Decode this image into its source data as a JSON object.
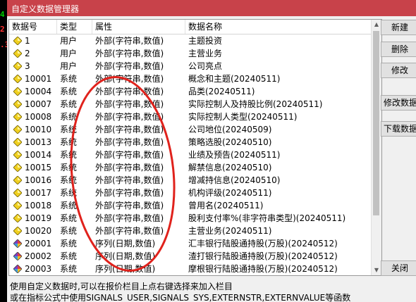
{
  "left_strip": [
    "4",
    "2",
    ".3"
  ],
  "title": "自定义数据管理器",
  "columns": [
    "数据号",
    "类型",
    "属性",
    "数据名称"
  ],
  "rows": [
    {
      "id": "1",
      "type": "用户",
      "attr": "外部(字符串,数值)",
      "name": "主题投资",
      "icon": "yellow-diamond-icon"
    },
    {
      "id": "2",
      "type": "用户",
      "attr": "外部(字符串,数值)",
      "name": "主营业务",
      "icon": "yellow-diamond-icon"
    },
    {
      "id": "3",
      "type": "用户",
      "attr": "外部(字符串,数值)",
      "name": "公司亮点",
      "icon": "yellow-diamond-icon"
    },
    {
      "id": "10001",
      "type": "系统",
      "attr": "外部(字符串,数值)",
      "name": "概念和主题(20240511)",
      "icon": "yellow-diamond-icon"
    },
    {
      "id": "10004",
      "type": "系统",
      "attr": "外部(字符串,数值)",
      "name": "品类(20240511)",
      "icon": "yellow-diamond-icon"
    },
    {
      "id": "10007",
      "type": "系统",
      "attr": "外部(字符串,数值)",
      "name": "实际控制人及持股比例(20240511)",
      "icon": "yellow-diamond-icon"
    },
    {
      "id": "10008",
      "type": "系统",
      "attr": "外部(字符串,数值)",
      "name": "实际控制人类型(20240511)",
      "icon": "yellow-diamond-icon"
    },
    {
      "id": "10010",
      "type": "系统",
      "attr": "外部(字符串,数值)",
      "name": "公司地位(20240509)",
      "icon": "yellow-diamond-icon"
    },
    {
      "id": "10013",
      "type": "系统",
      "attr": "外部(字符串,数值)",
      "name": "策略选股(20240510)",
      "icon": "yellow-diamond-icon"
    },
    {
      "id": "10014",
      "type": "系统",
      "attr": "外部(字符串,数值)",
      "name": "业绩及预告(20240511)",
      "icon": "yellow-diamond-icon"
    },
    {
      "id": "10015",
      "type": "系统",
      "attr": "外部(字符串,数值)",
      "name": "解禁信息(20240510)",
      "icon": "yellow-diamond-icon"
    },
    {
      "id": "10016",
      "type": "系统",
      "attr": "外部(字符串,数值)",
      "name": "增减持信息(20240510)",
      "icon": "yellow-diamond-icon"
    },
    {
      "id": "10017",
      "type": "系统",
      "attr": "外部(字符串,数值)",
      "name": "机构评级(20240511)",
      "icon": "yellow-diamond-icon"
    },
    {
      "id": "10018",
      "type": "系统",
      "attr": "外部(字符串,数值)",
      "name": "曾用名(20240511)",
      "icon": "yellow-diamond-icon"
    },
    {
      "id": "10019",
      "type": "系统",
      "attr": "外部(字符串,数值)",
      "name": "股利支付率%(非字符串类型)(20240511)",
      "icon": "yellow-diamond-icon"
    },
    {
      "id": "10020",
      "type": "系统",
      "attr": "外部(字符串,数值)",
      "name": "主营业务(20240511)",
      "icon": "yellow-diamond-icon"
    },
    {
      "id": "20001",
      "type": "系统",
      "attr": "序列(日期,数值)",
      "name": "汇丰银行陆股通持股(万股)(20240512)",
      "icon": "multicolor-diamond-icon"
    },
    {
      "id": "20002",
      "type": "系统",
      "attr": "序列(日期,数值)",
      "name": "渣打银行陆股通持股(万股)(20240512)",
      "icon": "multicolor-diamond-icon"
    },
    {
      "id": "20003",
      "type": "系统",
      "attr": "序列(日期,数值)",
      "name": "摩根银行陆股通持股(万股)(20240512)",
      "icon": "multicolor-diamond-icon"
    }
  ],
  "buttons": {
    "new": "新建",
    "delete": "删除",
    "modify": "修改",
    "modify_data": "修改数据",
    "download_data": "下载数据",
    "close": "关闭"
  },
  "status": {
    "line1": "使用自定义数据时,可以在报价栏目上点右键选择来加入栏目",
    "line2": "或在指标公式中使用SIGNALS_USER,SIGNALS_SYS,EXTERNSTR,EXTERNVALUE等函数"
  },
  "colors": {
    "title_bar": "#c8424a",
    "annotation_oval": "#e0221c",
    "strip_green": "#00d000",
    "strip_red": "#ff3030"
  }
}
